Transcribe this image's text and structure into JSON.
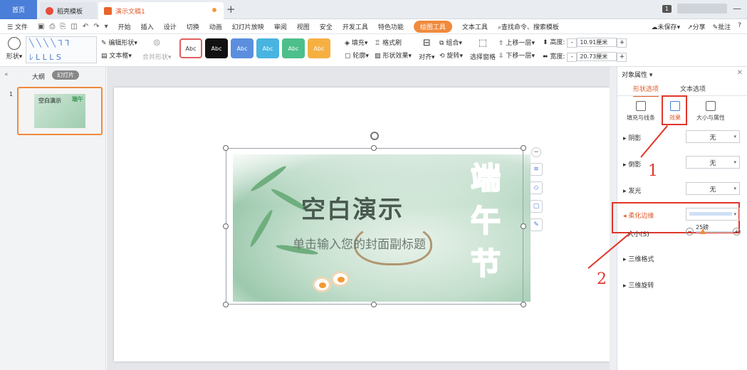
{
  "tabs": {
    "home": "首页",
    "template": "稻壳模板",
    "document": "演示文稿1",
    "page_badge": "1"
  },
  "menu": {
    "file": "文件",
    "items": [
      "开始",
      "插入",
      "设计",
      "切换",
      "动画",
      "幻灯片放映",
      "审阅",
      "视图",
      "安全",
      "开发工具",
      "特色功能"
    ],
    "active": "绘图工具",
    "text_tools": "文本工具",
    "search": "查找命令、搜索模板",
    "unsaved": "未保存",
    "share": "分享",
    "comment": "批注"
  },
  "ribbon": {
    "shape": "形状",
    "edit_shape": "编辑形状",
    "text_box": "文本框",
    "merge_shape": "合并形状",
    "style_label": "Abc",
    "styles": [
      {
        "bg": "#ffffff",
        "fg": "#333333",
        "border": "#e06060"
      },
      {
        "bg": "#111111",
        "fg": "#ffffff",
        "border": "#111111"
      },
      {
        "bg": "#5b8fde",
        "fg": "#ffffff",
        "border": "#5b8fde"
      },
      {
        "bg": "#48b4e0",
        "fg": "#ffffff",
        "border": "#48b4e0"
      },
      {
        "bg": "#4cbf8a",
        "fg": "#ffffff",
        "border": "#4cbf8a"
      },
      {
        "bg": "#f6b042",
        "fg": "#ffffff",
        "border": "#f6b042"
      }
    ],
    "fill": "填充",
    "outline": "轮廓",
    "format_brush": "格式刷",
    "shape_effect": "形状效果",
    "align": "对齐",
    "group": "组合",
    "rotate": "旋转",
    "selection_pane": "选择窗格",
    "bring_forward": "上移一层",
    "send_backward": "下移一层",
    "height_label": "高度:",
    "height_value": "10.91厘米",
    "width_label": "宽度:",
    "width_value": "20.73厘米",
    "plus": "+"
  },
  "left_panel": {
    "outline_tab": "大纲",
    "slides_tab": "幻灯片",
    "slide_number": "1",
    "thumb_title": "空白演示",
    "thumb_fest": "端午"
  },
  "slide": {
    "title": "空白演示",
    "subtitle": "单击输入您的封面副标题",
    "festival": [
      "端",
      "午",
      "节"
    ]
  },
  "right_panel": {
    "title": "对象属性",
    "tab_shape": "形状选项",
    "tab_text": "文本选项",
    "sub_fill": "填充与线条",
    "sub_effect": "效果",
    "sub_size": "大小与属性",
    "shadow": "阴影",
    "reflection": "倒影",
    "glow": "发光",
    "soft_edge": "柔化边缘",
    "size": "大小(S)",
    "three_d_format": "三维格式",
    "three_d_rotation": "三维旋转",
    "none": "无",
    "size_value": "25磅"
  },
  "annotations": {
    "one": "1",
    "two": "2"
  },
  "colors": {
    "accent": "#f08a3c",
    "highlight": "#e0362b",
    "primary": "#4a7ed8"
  }
}
